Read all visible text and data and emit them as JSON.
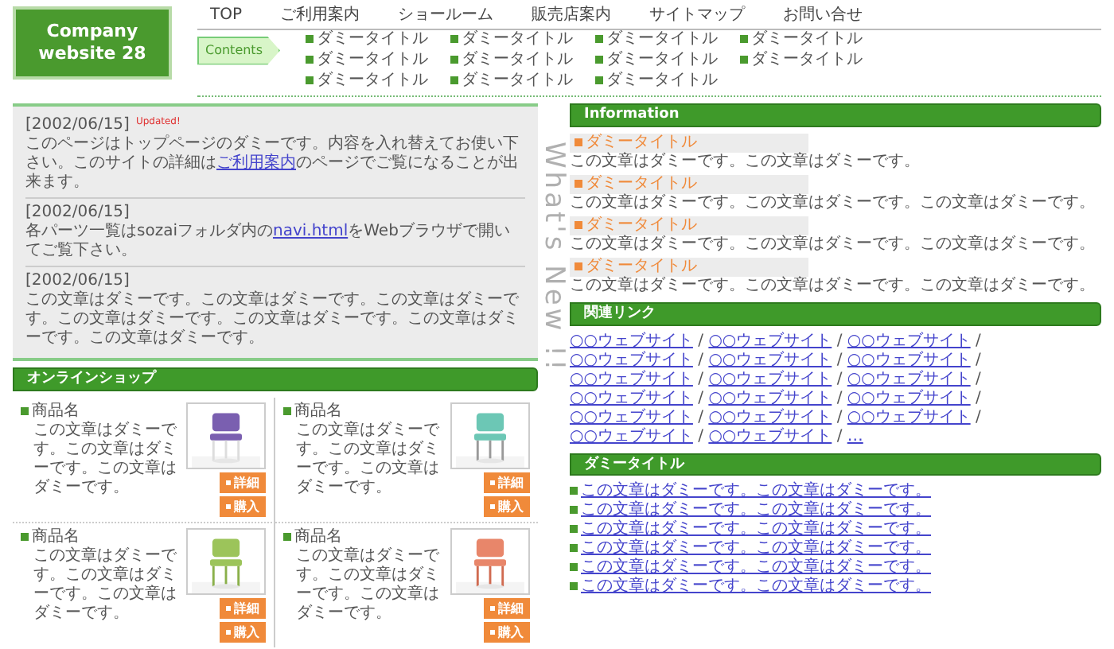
{
  "logo": {
    "lines": [
      "Company",
      "website 28"
    ]
  },
  "nav": [
    "TOP",
    "ご利用案内",
    "ショールーム",
    "販売店案内",
    "サイトマップ",
    "お問い合せ"
  ],
  "contents": {
    "tag": "Contents",
    "links": [
      "ダミータイトル",
      "ダミータイトル",
      "ダミータイトル",
      "ダミータイトル",
      "ダミータイトル",
      "ダミータイトル",
      "ダミータイトル",
      "ダミータイトル",
      "ダミータイトル",
      "ダミータイトル",
      "ダミータイトル"
    ]
  },
  "news": {
    "side_label": "What's New !!",
    "items": [
      {
        "date": "[2002/06/15]",
        "badge": "Updated!",
        "parts": [
          {
            "kind": "text",
            "text": "このページはトップページのダミーです。内容を入れ替えてお使い下さい。このサイトの詳細は"
          },
          {
            "kind": "link",
            "text": "ご利用案内"
          },
          {
            "kind": "text",
            "text": "のページでご覧になることが出来ます。"
          }
        ]
      },
      {
        "date": "[2002/06/15]",
        "parts": [
          {
            "kind": "text",
            "text": "各パーツ一覧はsozaiフォルダ内の"
          },
          {
            "kind": "link",
            "text": "navi.html"
          },
          {
            "kind": "text",
            "text": "をWebブラウザで開いてご覧下さい。"
          }
        ]
      },
      {
        "date": "[2002/06/15]",
        "parts": [
          {
            "kind": "text",
            "text": "この文章はダミーです。この文章はダミーです。この文章はダミーです。この文章はダミーです。この文章はダミーです。この文章はダミーです。この文章はダミーです。"
          }
        ]
      }
    ]
  },
  "shop": {
    "title": "オンラインショップ",
    "products": [
      {
        "name": "商品名",
        "text": "この文章はダミーです。この文章はダミーです。この文章はダミーです。",
        "buttons": [
          "詳細",
          "購入"
        ]
      },
      {
        "name": "商品名",
        "text": "この文章はダミーです。この文章はダミーです。この文章はダミーです。",
        "buttons": [
          "詳細",
          "購入"
        ]
      },
      {
        "name": "商品名",
        "text": "この文章はダミーです。この文章はダミーです。この文章はダミーです。",
        "buttons": [
          "詳細",
          "購入"
        ]
      },
      {
        "name": "商品名",
        "text": "この文章はダミーです。この文章はダミーです。この文章はダミーです。",
        "buttons": [
          "詳細",
          "購入"
        ]
      }
    ]
  },
  "information": {
    "title": "Information",
    "items": [
      {
        "title": "ダミータイトル",
        "text": "この文章はダミーです。この文章はダミーです。"
      },
      {
        "title": "ダミータイトル",
        "text": "この文章はダミーです。この文章はダミーです。この文章はダミーです。"
      },
      {
        "title": "ダミータイトル",
        "text": "この文章はダミーです。この文章はダミーです。この文章はダミーです。"
      },
      {
        "title": "ダミータイトル",
        "text": "この文章はダミーです。この文章はダミーです。この文章はダミーです。"
      }
    ]
  },
  "links": {
    "title": "関連リンク",
    "separator": "/",
    "items": [
      "○○ウェブサイト",
      "○○ウェブサイト",
      "○○ウェブサイト",
      "○○ウェブサイト",
      "○○ウェブサイト",
      "○○ウェブサイト",
      "○○ウェブサイト",
      "○○ウェブサイト",
      "○○ウェブサイト",
      "○○ウェブサイト",
      "○○ウェブサイト",
      "○○ウェブサイト",
      "○○ウェブサイト",
      "○○ウェブサイト",
      "○○ウェブサイト",
      "○○ウェブサイト",
      "○○ウェブサイト",
      "…"
    ]
  },
  "dummy": {
    "title": "ダミータイトル",
    "items": [
      "この文章はダミーです。この文章はダミーです。",
      "この文章はダミーです。この文章はダミーです。",
      "この文章はダミーです。この文章はダミーです。",
      "この文章はダミーです。この文章はダミーです。",
      "この文章はダミーです。この文章はダミーです。",
      "この文章はダミーです。この文章はダミーです。"
    ]
  }
}
